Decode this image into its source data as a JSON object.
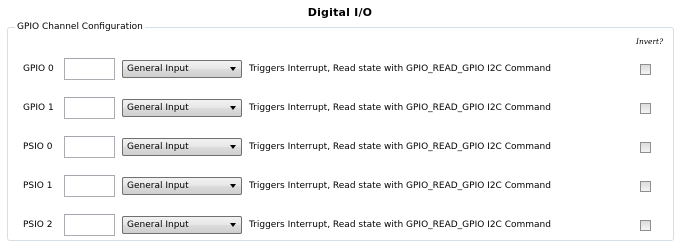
{
  "page": {
    "title": "Digital I/O"
  },
  "group": {
    "title": "GPIO Channel Configuration",
    "invert_header": "Invert?"
  },
  "rows": [
    {
      "label": "GPIO 0",
      "value": "",
      "mode": "General Input",
      "description": "Triggers Interrupt, Read state with GPIO_READ_GPIO I2C Command",
      "invert_checked": false
    },
    {
      "label": "GPIO 1",
      "value": "",
      "mode": "General Input",
      "description": "Triggers Interrupt, Read state with GPIO_READ_GPIO I2C Command",
      "invert_checked": false
    },
    {
      "label": "PSIO 0",
      "value": "",
      "mode": "General Input",
      "description": "Triggers Interrupt, Read state with GPIO_READ_GPIO I2C Command",
      "invert_checked": false
    },
    {
      "label": "PSIO 1",
      "value": "",
      "mode": "General Input",
      "description": "Triggers Interrupt, Read state with GPIO_READ_GPIO I2C Command",
      "invert_checked": false
    },
    {
      "label": "PSIO 2",
      "value": "",
      "mode": "General Input",
      "description": "Triggers Interrupt, Read state with GPIO_READ_GPIO I2C Command",
      "invert_checked": false
    }
  ]
}
